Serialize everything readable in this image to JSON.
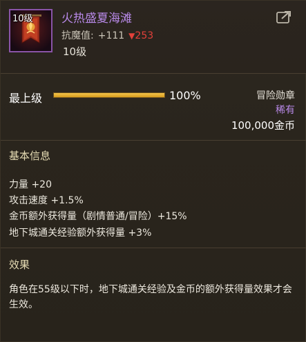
{
  "item": {
    "icon_level": "10级",
    "name": "火热盛夏海滩",
    "stat_label": "抗魔值:",
    "stat_plus": "+111",
    "stat_arrow": "▼",
    "stat_down": "253",
    "level": "10级",
    "icon": "banner-icon",
    "share_icon": "share-icon"
  },
  "grade": {
    "label": "最上级",
    "progress_percent": 100,
    "progress_text": "100%"
  },
  "meta": {
    "type": "冒险勋章",
    "rarity": "稀有",
    "price": "100,000金币"
  },
  "basic_info": {
    "title": "基本信息",
    "stats": [
      "力量 +20",
      "攻击速度 +1.5%",
      "金币额外获得量（剧情普通/冒险）+15%",
      "地下城通关经验额外获得量 +3%"
    ]
  },
  "effect": {
    "title": "效果",
    "description": "角色在55级以下时，地下城通关经验及金币的额外获得量效果才会生效。"
  },
  "colors": {
    "background": "#2a241c",
    "name_purple": "#b889e8",
    "down_red": "#e3403a",
    "progress_gold": "#f4c44a",
    "section_title": "#e6dcb4"
  }
}
